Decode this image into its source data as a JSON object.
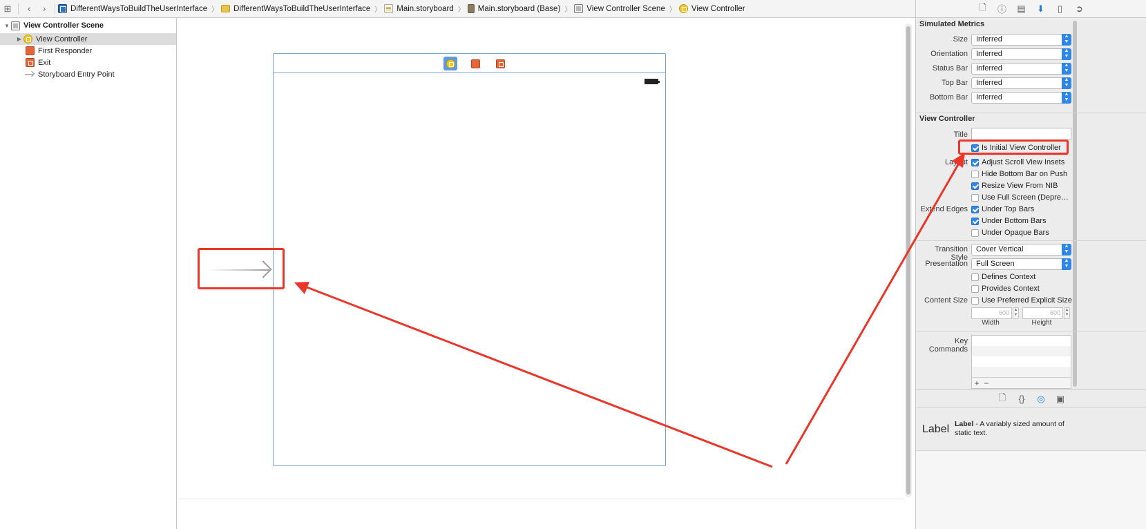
{
  "breadcrumbs": [
    {
      "label": "DifferentWaysToBuildTheUserInterface",
      "icon": "project-icon"
    },
    {
      "label": "DifferentWaysToBuildTheUserInterface",
      "icon": "folder-icon"
    },
    {
      "label": "Main.storyboard",
      "icon": "storyboard-icon"
    },
    {
      "label": "Main.storyboard (Base)",
      "icon": "storyboard-base-icon"
    },
    {
      "label": "View Controller Scene",
      "icon": "scene-icon"
    },
    {
      "label": "View Controller",
      "icon": "view-controller-icon"
    }
  ],
  "outline": {
    "scene": "View Controller Scene",
    "items": [
      {
        "label": "View Controller"
      },
      {
        "label": "First Responder"
      },
      {
        "label": "Exit"
      },
      {
        "label": "Storyboard Entry Point"
      }
    ]
  },
  "inspector": {
    "simulated_metrics": {
      "title": "Simulated Metrics",
      "rows": [
        {
          "label": "Size",
          "value": "Inferred"
        },
        {
          "label": "Orientation",
          "value": "Inferred"
        },
        {
          "label": "Status Bar",
          "value": "Inferred"
        },
        {
          "label": "Top Bar",
          "value": "Inferred"
        },
        {
          "label": "Bottom Bar",
          "value": "Inferred"
        }
      ]
    },
    "view_controller": {
      "title": "View Controller",
      "title_label": "Title",
      "title_value": "",
      "is_initial": "Is Initial View Controller",
      "layout_label": "Layout",
      "layout_options": [
        {
          "label": "Adjust Scroll View Insets",
          "checked": true
        },
        {
          "label": "Hide Bottom Bar on Push",
          "checked": false
        },
        {
          "label": "Resize View From NIB",
          "checked": true
        },
        {
          "label": "Use Full Screen (Depre…",
          "checked": false
        }
      ],
      "extend_edges_label": "Extend Edges",
      "extend_edges": [
        {
          "label": "Under Top Bars",
          "checked": true
        },
        {
          "label": "Under Bottom Bars",
          "checked": true
        },
        {
          "label": "Under Opaque Bars",
          "checked": false
        }
      ],
      "transition_style_label": "Transition Style",
      "transition_style": "Cover Vertical",
      "presentation_label": "Presentation",
      "presentation": "Full Screen",
      "defines_context": "Defines Context",
      "provides_context": "Provides Context",
      "content_size_label": "Content Size",
      "use_preferred": "Use Preferred Explicit Size",
      "width_value": "600",
      "height_value": "600",
      "width_label": "Width",
      "height_label": "Height",
      "key_commands_label": "Key Commands"
    }
  },
  "library": {
    "icon_text": "Label",
    "name": "Label",
    "description": " - A variably sized amount of static text."
  },
  "colors": {
    "highlight": "#e8372a",
    "accent": "#2f86e9",
    "scene_border": "#7fa6d1"
  }
}
